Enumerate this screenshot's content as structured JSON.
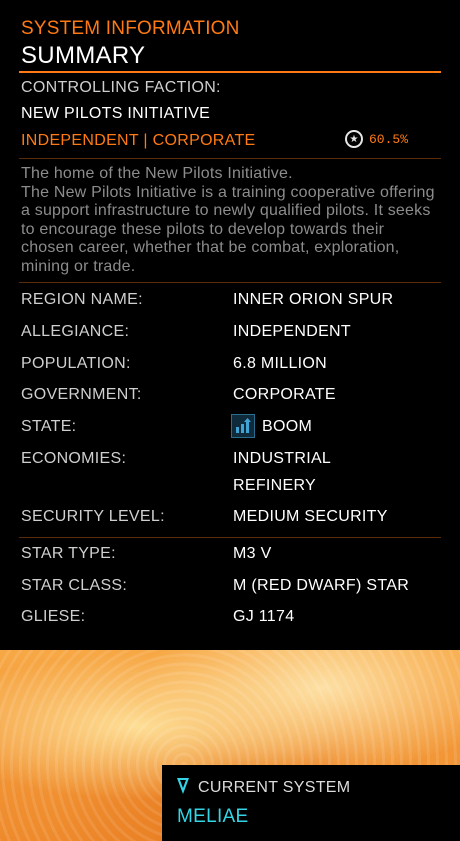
{
  "header": {
    "title": "SYSTEM INFORMATION",
    "subtitle": "SUMMARY"
  },
  "faction": {
    "label": "CONTROLLING FACTION:",
    "name": "NEW PILOTS INITIATIVE",
    "type": "INDEPENDENT | CORPORATE",
    "reputation": "60.5%"
  },
  "description": {
    "line1": "The home of the New Pilots Initiative.",
    "line2": "The New Pilots Initiative is a training cooperative offering a support infrastructure to newly qualified pilots. It seeks to encourage these pilots to develop towards their chosen career, whether that be combat, exploration, mining or trade."
  },
  "details": {
    "region": {
      "label": "REGION NAME:",
      "value": "INNER ORION SPUR"
    },
    "allegiance": {
      "label": "ALLEGIANCE:",
      "value": "INDEPENDENT"
    },
    "population": {
      "label": "POPULATION:",
      "value": "6.8 MILLION"
    },
    "government": {
      "label": "GOVERNMENT:",
      "value": "CORPORATE"
    },
    "state": {
      "label": "STATE:",
      "value": "BOOM"
    },
    "economies": {
      "label": "ECONOMIES:",
      "values": [
        "INDUSTRIAL",
        "REFINERY"
      ]
    },
    "security": {
      "label": "SECURITY LEVEL:",
      "value": "MEDIUM SECURITY"
    }
  },
  "star": {
    "type": {
      "label": "STAR TYPE:",
      "value": "M3 V"
    },
    "class": {
      "label": "STAR CLASS:",
      "value": "M (RED DWARF) STAR"
    },
    "gliese": {
      "label": "GLIESE:",
      "value": "GJ 1174"
    }
  },
  "current_system": {
    "label": "CURRENT SYSTEM",
    "name": "MELIAE"
  },
  "colors": {
    "accent": "#ff7a14",
    "current": "#33d5e6"
  },
  "icons": {
    "reputation": "reputation-icon",
    "state": "boom-state-icon",
    "location": "location-marker-icon"
  }
}
